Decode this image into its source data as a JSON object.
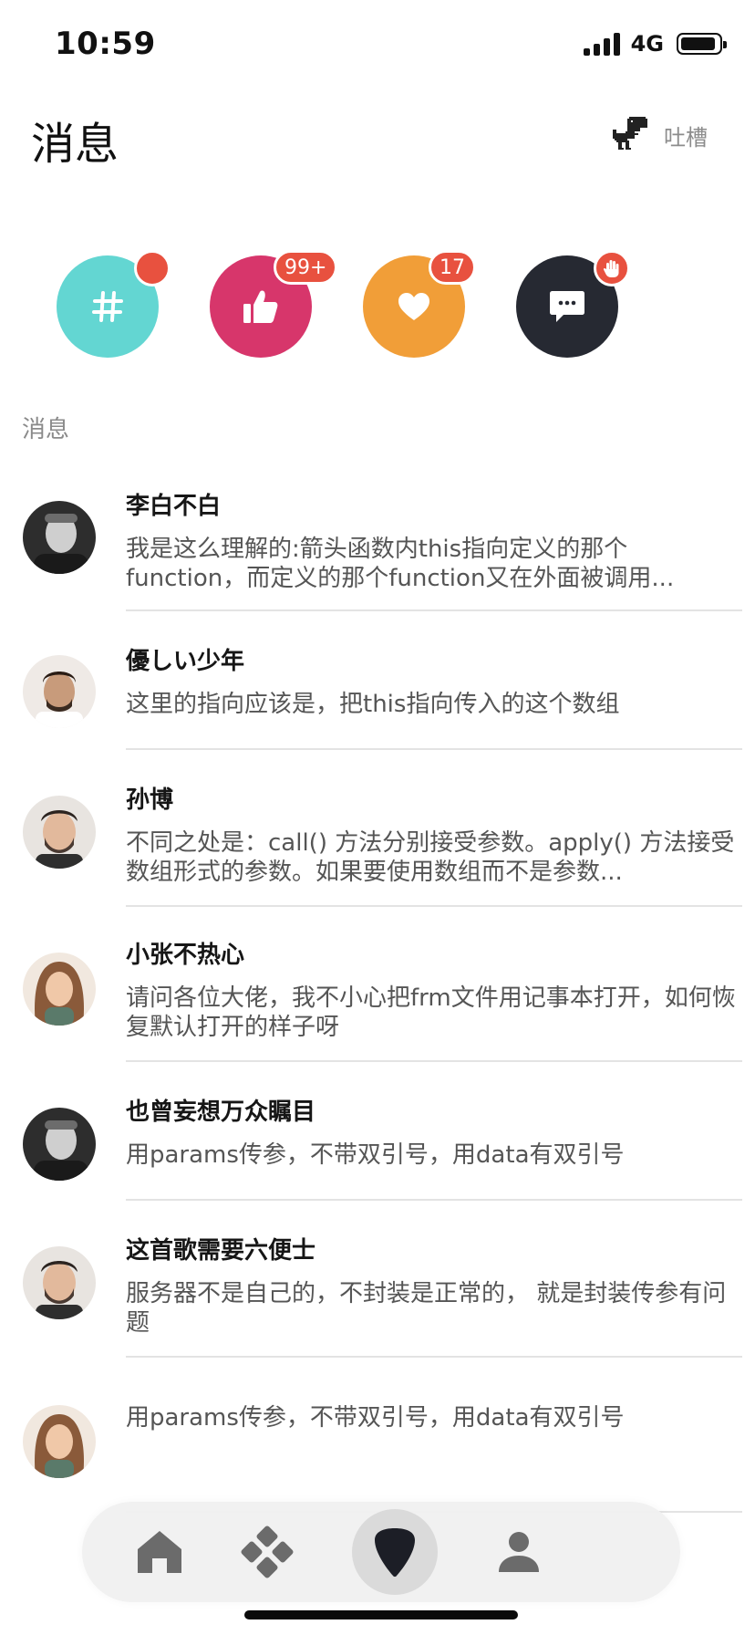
{
  "status_bar": {
    "time": "10:59",
    "network": "4G",
    "battery_level": 0.92
  },
  "header": {
    "title": "消息",
    "feedback_label": "吐槽",
    "feedback_icon": "dino-icon"
  },
  "quick_actions": [
    {
      "name": "topics",
      "icon": "hash-icon",
      "color": "#63d6d2",
      "badge": "",
      "badge_type": "dot"
    },
    {
      "name": "likes",
      "icon": "thumbs-up-icon",
      "color": "#d7366b",
      "badge": "99+",
      "badge_type": "count"
    },
    {
      "name": "favorites",
      "icon": "heart-icon",
      "color": "#f19e38",
      "badge": "17",
      "badge_type": "count"
    },
    {
      "name": "comments",
      "icon": "chat-bubble-icon",
      "color": "#262932",
      "badge": "",
      "badge_type": "hand"
    }
  ],
  "section": {
    "label": "消息"
  },
  "messages": [
    {
      "name": "李白不白",
      "text": "我是这么理解的:箭头函数内this指向定义的那个function，而定义的那个function又在外面被调用...",
      "avatar": "man-gray"
    },
    {
      "name": "優しい少年",
      "text": "这里的指向应该是，把this指向传入的这个数组",
      "avatar": "man-smile"
    },
    {
      "name": "孙博",
      "text": "不同之处是：call() 方法分别接受参数。apply() 方法接受数组形式的参数。如果要使用数组而不是参数...",
      "avatar": "man-beard"
    },
    {
      "name": "小张不热心",
      "text": "请问各位大佬，我不小心把frm文件用记事本打开，如何恢复默认打开的样子呀",
      "avatar": "woman"
    },
    {
      "name": "也曾妄想万众瞩目",
      "text": "用params传参，不带双引号，用data有双引号",
      "avatar": "man-gray"
    },
    {
      "name": "这首歌需要六便士",
      "text": "服务器不是自己的，不封装是正常的， 就是封装传参有问题",
      "avatar": "man-beard"
    },
    {
      "name": "",
      "text": "用params传参，不带双引号，用data有双引号",
      "avatar": "woman"
    }
  ],
  "tab_bar": {
    "tabs": [
      {
        "name": "home",
        "icon": "home-icon",
        "active": false
      },
      {
        "name": "discover",
        "icon": "diamond-grid-icon",
        "active": false
      },
      {
        "name": "messages",
        "icon": "pick-icon",
        "active": true
      },
      {
        "name": "profile",
        "icon": "person-icon",
        "active": false
      }
    ]
  }
}
